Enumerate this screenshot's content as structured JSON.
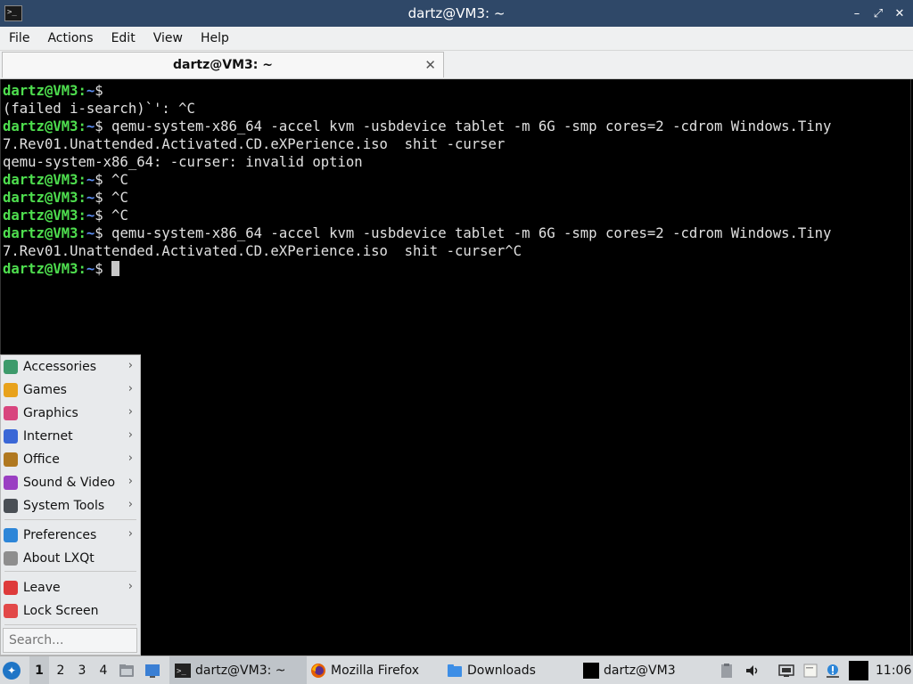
{
  "window": {
    "title": "dartz@VM3: ~",
    "app_icon": ">_"
  },
  "window_controls": {
    "minimize": "–",
    "restore": "⤢",
    "close": "✕"
  },
  "menubar": [
    "File",
    "Actions",
    "Edit",
    "View",
    "Help"
  ],
  "tab": {
    "label": "dartz@VM3: ~",
    "close": "✕"
  },
  "terminal": {
    "lines": [
      {
        "user": "dartz@VM3",
        "path": "~",
        "text": "$ "
      },
      {
        "text": "(failed i-search)`': ^C"
      },
      {
        "user": "dartz@VM3",
        "path": "~",
        "text": "$ qemu-system-x86_64 -accel kvm -usbdevice tablet -m 6G -smp cores=2 -cdrom Windows.Tiny"
      },
      {
        "text": "7.Rev01.Unattended.Activated.CD.eXPerience.iso  shit -curser"
      },
      {
        "text": "qemu-system-x86_64: -curser: invalid option"
      },
      {
        "user": "dartz@VM3",
        "path": "~",
        "text": "$ ^C"
      },
      {
        "user": "dartz@VM3",
        "path": "~",
        "text": "$ ^C"
      },
      {
        "user": "dartz@VM3",
        "path": "~",
        "text": "$ ^C"
      },
      {
        "user": "dartz@VM3",
        "path": "~",
        "text": "$ qemu-system-x86_64 -accel kvm -usbdevice tablet -m 6G -smp cores=2 -cdrom Windows.Tiny"
      },
      {
        "text": "7.Rev01.Unattended.Activated.CD.eXPerience.iso  shit -curser^C"
      },
      {
        "user": "dartz@VM3",
        "path": "~",
        "text": "$ ",
        "cursor": true
      }
    ]
  },
  "app_menu": {
    "items": [
      {
        "label": "Accessories",
        "icon": "accessories-icon",
        "color": "#3d9a6b",
        "submenu": true
      },
      {
        "label": "Games",
        "icon": "games-icon",
        "color": "#e8a21c",
        "submenu": true
      },
      {
        "label": "Graphics",
        "icon": "graphics-icon",
        "color": "#d8457e",
        "submenu": true
      },
      {
        "label": "Internet",
        "icon": "internet-icon",
        "color": "#3a67d6",
        "submenu": true
      },
      {
        "label": "Office",
        "icon": "office-icon",
        "color": "#b07820",
        "submenu": true
      },
      {
        "label": "Sound & Video",
        "icon": "sound-video-icon",
        "color": "#9a3fc2",
        "submenu": true
      },
      {
        "label": "System Tools",
        "icon": "system-tools-icon",
        "color": "#4a4f55",
        "submenu": true
      },
      {
        "label": "Preferences",
        "icon": "preferences-icon",
        "color": "#2d86d8",
        "submenu": true
      },
      {
        "label": "About LXQt",
        "icon": "about-icon",
        "color": "#8e8e8e",
        "submenu": false
      },
      {
        "label": "Leave",
        "icon": "leave-icon",
        "color": "#de3a3a",
        "submenu": true
      },
      {
        "label": "Lock Screen",
        "icon": "lock-icon",
        "color": "#e24848",
        "submenu": false
      }
    ],
    "submenu_arrow": "›",
    "search_placeholder": "Search..."
  },
  "taskbar": {
    "desktops": [
      "1",
      "2",
      "3",
      "4"
    ],
    "active_desktop": "1",
    "tasks": [
      {
        "label": "dartz@VM3: ~",
        "icon": "terminal-icon",
        "active": true
      },
      {
        "label": "Mozilla Firefox",
        "icon": "firefox-icon",
        "active": false
      },
      {
        "label": "Downloads",
        "icon": "folder-icon",
        "active": false
      },
      {
        "label": "dartz@VM3",
        "icon": "terminal-icon",
        "active": false
      }
    ],
    "clock": "11:06"
  }
}
